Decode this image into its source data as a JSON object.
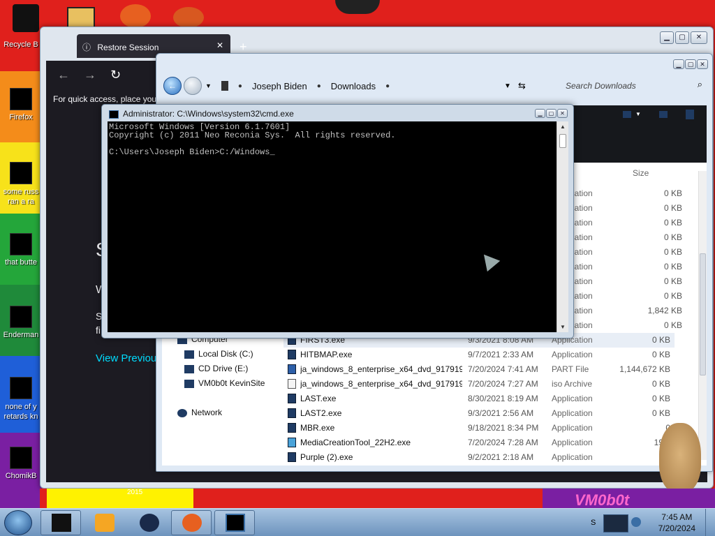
{
  "desktop": {
    "icons": [
      {
        "label": "Recycle B"
      },
      {
        "label": "Firefox"
      },
      {
        "label": "some russ ran a ra"
      },
      {
        "label": "that butte"
      },
      {
        "label": "Enderman"
      },
      {
        "label": "none of y retards kn"
      },
      {
        "label": "ChomikB"
      }
    ],
    "year_label": "2015",
    "wallpaper_text": "VM0b0t"
  },
  "browser": {
    "tab_title": "Restore Session",
    "quick_access": "For quick access, place your",
    "heading_char": "S",
    "line_w": "W",
    "line_s": "S",
    "line_f": "fi",
    "view_previous": "View Previou",
    "new_tab_symbol": "+"
  },
  "explorer": {
    "breadcrumb": [
      "Joseph Biden",
      "Downloads"
    ],
    "search_placeholder": "Search Downloads",
    "column_size": "Size",
    "partial_rows": [
      {
        "type": "ication",
        "size": "0 KB"
      },
      {
        "type": "ication",
        "size": "0 KB"
      },
      {
        "type": "ication",
        "size": "0 KB"
      },
      {
        "type": "ication",
        "size": "0 KB"
      },
      {
        "type": "ication",
        "size": "0 KB"
      },
      {
        "type": "ication",
        "size": "0 KB"
      },
      {
        "type": "ication",
        "size": "0 KB"
      },
      {
        "type": "ication",
        "size": "0 KB"
      },
      {
        "type": "ication",
        "size": "1,842 KB"
      },
      {
        "type": "ication",
        "size": "0 KB"
      }
    ],
    "rows": [
      {
        "name": "FIRST3.exe",
        "date": "9/3/2021 8:08 AM",
        "type": "Application",
        "size": "0 KB",
        "selected": true
      },
      {
        "name": "HITBMAP.exe",
        "date": "9/7/2021 2:33 AM",
        "type": "Application",
        "size": "0 KB"
      },
      {
        "name": "ja_windows_8_enterprise_x64_dvd_917919...",
        "date": "7/20/2024 7:41 AM",
        "type": "PART File",
        "size": "1,144,672 KB"
      },
      {
        "name": "ja_windows_8_enterprise_x64_dvd_917919...",
        "date": "7/20/2024 7:27 AM",
        "type": "iso Archive",
        "size": "0 KB"
      },
      {
        "name": "LAST.exe",
        "date": "8/30/2021 8:19 AM",
        "type": "Application",
        "size": "0 KB"
      },
      {
        "name": "LAST2.exe",
        "date": "9/3/2021 2:56 AM",
        "type": "Application",
        "size": "0 KB"
      },
      {
        "name": "MBR.exe",
        "date": "9/18/2021 8:34 PM",
        "type": "Application",
        "size": "0"
      },
      {
        "name": "MediaCreationTool_22H2.exe",
        "date": "7/20/2024 7:28 AM",
        "type": "Application",
        "size": "19,0"
      },
      {
        "name": "Purple (2).exe",
        "date": "9/2/2021 2:18 AM",
        "type": "Application",
        "size": ""
      }
    ],
    "tree": [
      {
        "label": "Computer"
      },
      {
        "label": "Local Disk (C:)"
      },
      {
        "label": "CD Drive (E:)"
      },
      {
        "label": "VM0b0t KevinSite"
      },
      {
        "label": "Network"
      }
    ]
  },
  "cmd": {
    "title": "Administrator: C:\\Windows\\system32\\cmd.exe",
    "line1": "Microsoft Windows [Version 6.1.7601]",
    "line2": "Copyright (c) 2011 Neo Reconia Sys.  All rights reserved.",
    "line3": "",
    "line4": "C:\\Users\\Joseph Biden>C:/Windows_"
  },
  "taskbar": {
    "time": "7:45 AM",
    "date": "7/20/2024",
    "tray_letter": "S"
  },
  "colors": {
    "wallpaper_red": "#e0201c",
    "browser_dark": "#1c1b22",
    "link_cyan": "#00ddff"
  }
}
